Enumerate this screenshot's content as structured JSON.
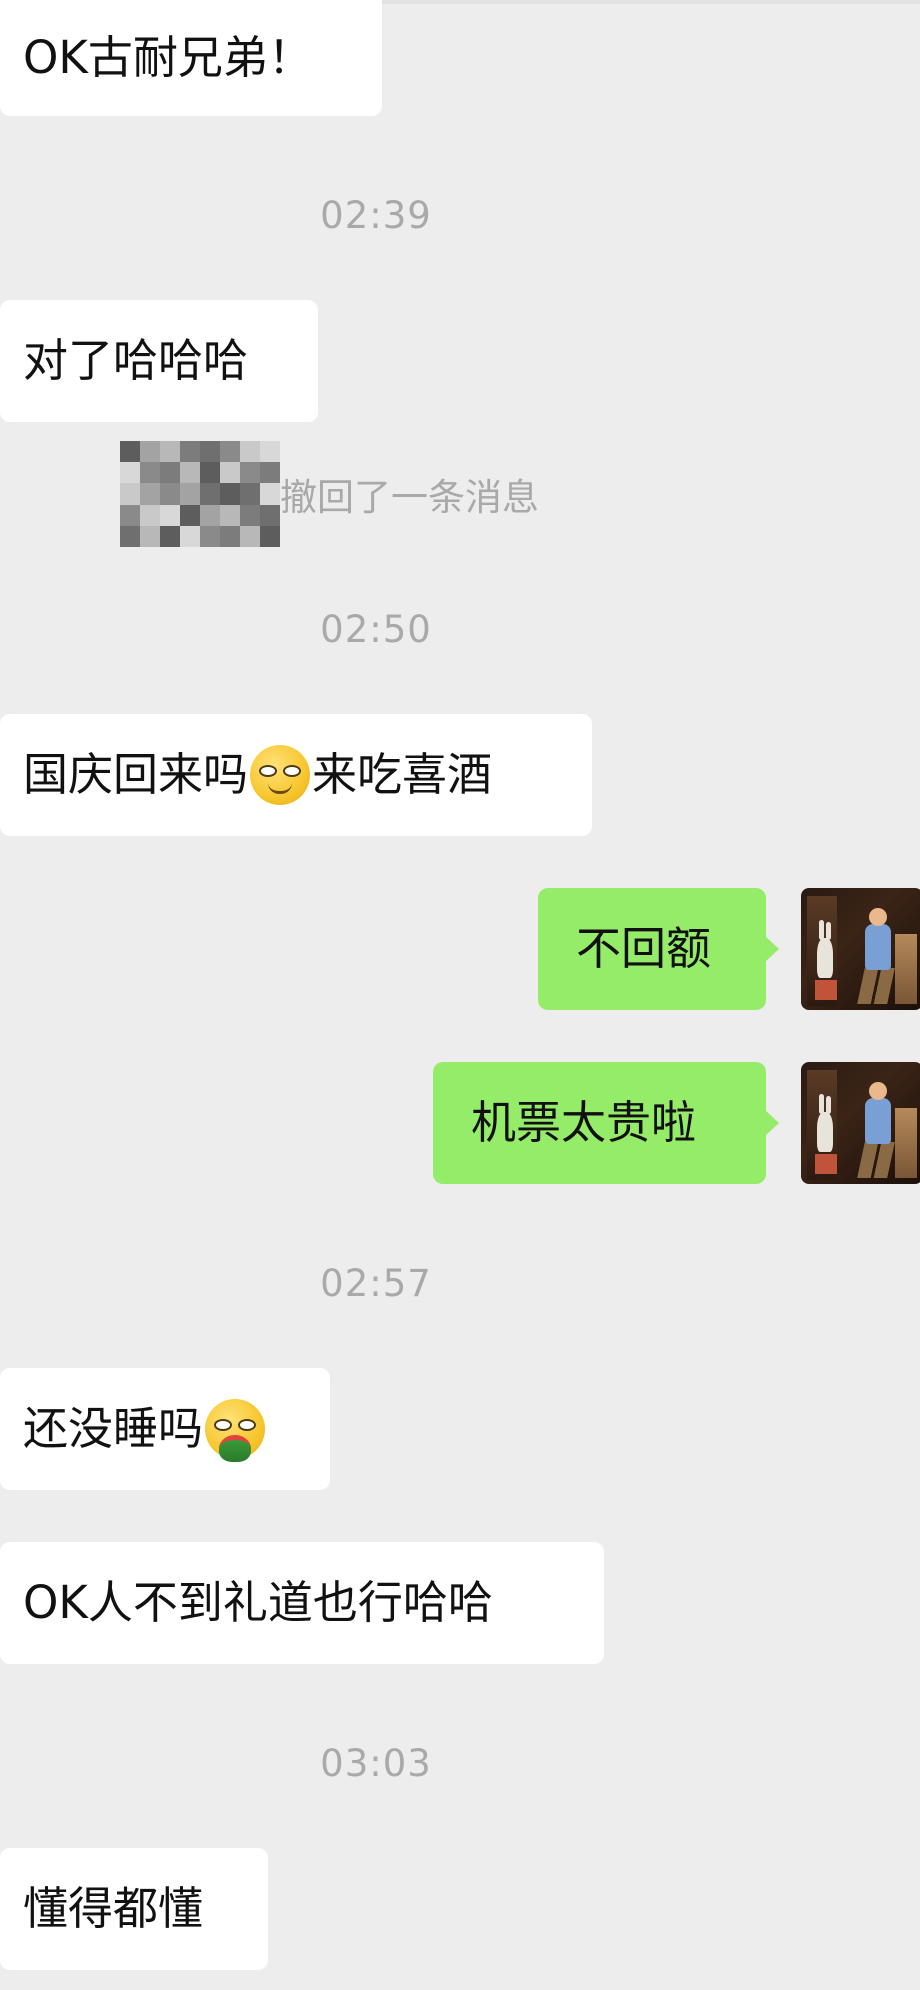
{
  "messages": {
    "m1": "OK古耐兄弟！",
    "t1": "02:39",
    "m2": "对了哈哈哈",
    "recall": "撤回了一条消息",
    "t2": "02:50",
    "m3_a": "国庆回来吗",
    "m3_b": "来吃喜酒",
    "m4": "不回额",
    "m5": "机票太贵啦",
    "t3": "02:57",
    "m6": "还没睡吗",
    "m7": "OK人不到礼道也行哈哈",
    "t4": "03:03",
    "m8": "懂得都懂"
  },
  "icons": {
    "emoji_smirk": "smirk-emoji-icon",
    "emoji_eating": "eating-watermelon-emoji-icon",
    "mosaic": "mosaic-censor-icon",
    "avatar": "user-avatar"
  },
  "colors": {
    "background": "#ededed",
    "incoming_bubble": "#ffffff",
    "outgoing_bubble": "#95ec69",
    "timestamp": "#a9a9a9"
  }
}
